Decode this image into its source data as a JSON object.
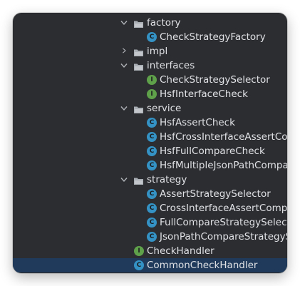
{
  "colors": {
    "background": "#2b2d30",
    "text": "#dfe1e5",
    "class_icon": "#3592c4",
    "interface_icon": "#5fa14a",
    "selected_row": "#1f3a5a"
  },
  "tree": {
    "factory": {
      "label": "factory",
      "icon": "folder-icon",
      "expanded": true,
      "items": [
        {
          "label": "CheckStrategyFactory",
          "icon": "class-icon",
          "icon_letter": "C"
        }
      ]
    },
    "impl": {
      "label": "impl",
      "icon": "folder-icon",
      "expanded": false
    },
    "interfaces": {
      "label": "interfaces",
      "icon": "folder-icon",
      "expanded": true,
      "items": [
        {
          "label": "CheckStrategySelector",
          "icon": "interface-icon",
          "icon_letter": "I"
        },
        {
          "label": "HsfInterfaceCheck",
          "icon": "interface-icon",
          "icon_letter": "I"
        }
      ]
    },
    "service": {
      "label": "service",
      "icon": "folder-icon",
      "expanded": true,
      "items": [
        {
          "label": "HsfAssertCheck",
          "icon": "class-icon",
          "icon_letter": "C"
        },
        {
          "label": "HsfCrossInterfaceAssertCo",
          "icon": "class-icon",
          "icon_letter": "C"
        },
        {
          "label": "HsfFullCompareCheck",
          "icon": "class-icon",
          "icon_letter": "C"
        },
        {
          "label": "HsfMultipleJsonPathCompa",
          "icon": "class-icon",
          "icon_letter": "C"
        }
      ]
    },
    "strategy": {
      "label": "strategy",
      "icon": "folder-icon",
      "expanded": true,
      "items": [
        {
          "label": "AssertStrategySelector",
          "icon": "class-icon",
          "icon_letter": "C"
        },
        {
          "label": "CrossInterfaceAssertCompa",
          "icon": "class-icon",
          "icon_letter": "C"
        },
        {
          "label": "FullCompareStrategySelect",
          "icon": "class-icon",
          "icon_letter": "C"
        },
        {
          "label": "JsonPathCompareStrategyS",
          "icon": "class-icon",
          "icon_letter": "C"
        }
      ]
    },
    "root_items": [
      {
        "label": "CheckHandler",
        "icon": "interface-icon",
        "icon_letter": "I"
      },
      {
        "label": "CommonCheckHandler",
        "icon": "class-icon",
        "icon_letter": "C",
        "selected": true
      }
    ]
  }
}
